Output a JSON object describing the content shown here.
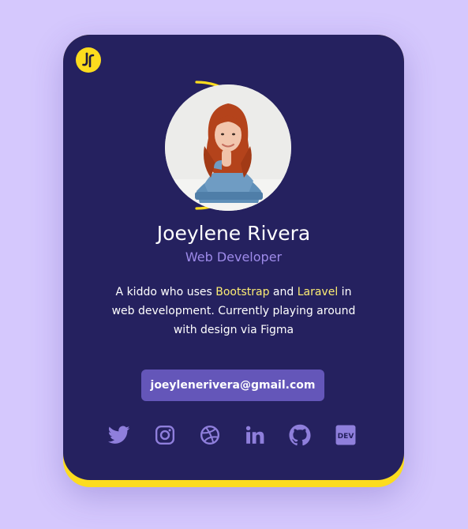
{
  "profile": {
    "logo_glyph": "JR",
    "name": "Joeylene Rivera",
    "role": "Web Developer",
    "bio": {
      "part1": "A kiddo who uses ",
      "highlight1": "Bootstrap",
      "part2": " and ",
      "highlight2": "Laravel",
      "part3": " in web development. Currently playing around with design via Figma"
    },
    "email": "joeylenerivera@gmail.com"
  },
  "social_icons": [
    "twitter-icon",
    "instagram-icon",
    "dribbble-icon",
    "linkedin-icon",
    "github-icon",
    "dev-icon"
  ],
  "social_labels": {
    "dev": "DEV"
  },
  "colors": {
    "page_background": "#d5c8fd",
    "card_background": "#25215f",
    "accent_yellow": "#fcdc1e",
    "role_purple": "#9e8bea",
    "button_purple": "#6456b9",
    "icon_purple": "#8f7fdc",
    "highlight_yellow": "#fcec73"
  }
}
